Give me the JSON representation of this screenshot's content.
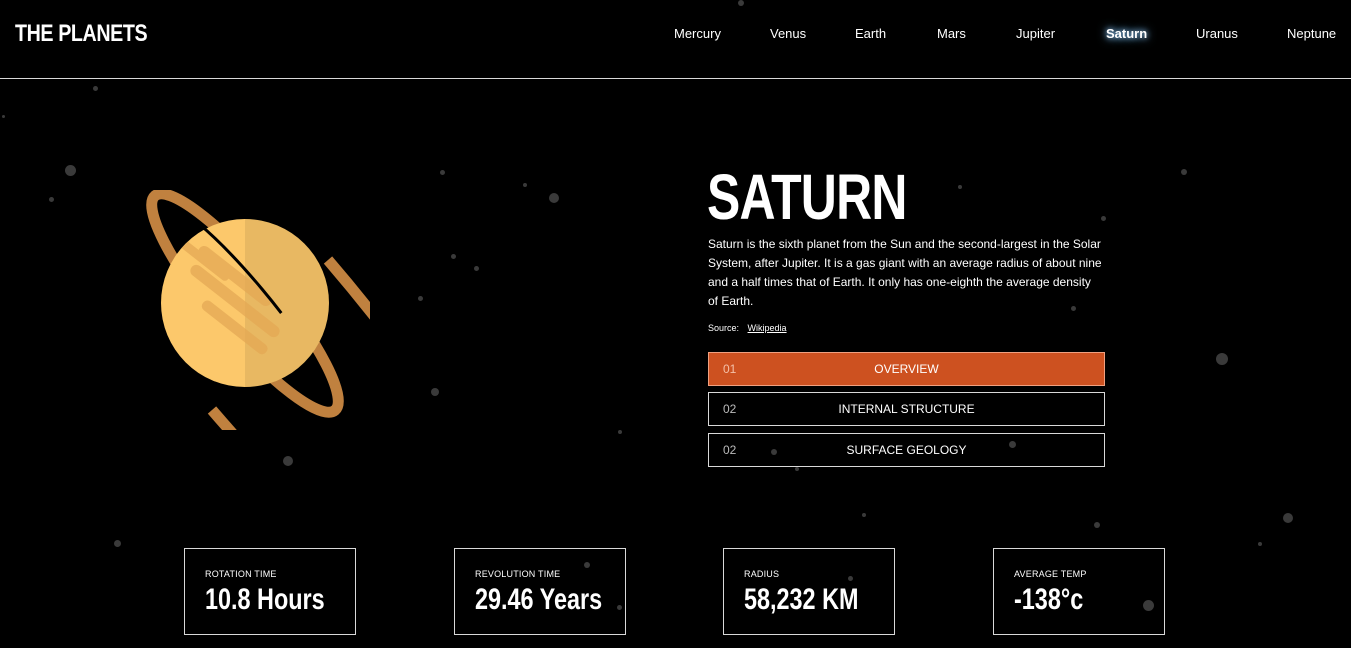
{
  "header": {
    "logo": "THE PLANETS",
    "nav": [
      "Mercury",
      "Venus",
      "Earth",
      "Mars",
      "Jupiter",
      "Saturn",
      "Uranus",
      "Neptune"
    ],
    "active": "Saturn"
  },
  "planet": {
    "name": "SATURN",
    "description": "Saturn is the sixth planet from the Sun and the second-largest in the Solar System, after Jupiter. It is a gas giant with an average radius of about nine and a half times that of Earth. It only has one-eighth the average density of Earth.",
    "source_label": "Source:",
    "source_link": "Wikipedia"
  },
  "tabs": [
    {
      "num": "01",
      "label": "OVERVIEW"
    },
    {
      "num": "02",
      "label": "INTERNAL STRUCTURE"
    },
    {
      "num": "02",
      "label": "SURFACE GEOLOGY"
    }
  ],
  "stats": [
    {
      "label": "ROTATION TIME",
      "value": "10.8 Hours"
    },
    {
      "label": "REVOLUTION TIME",
      "value": "29.46 Years"
    },
    {
      "label": "RADIUS",
      "value": "58,232 KM"
    },
    {
      "label": "AVERAGE TEMP",
      "value": "-138°c"
    }
  ],
  "colors": {
    "accent": "#cd5120",
    "planet_light": "#fcc86b",
    "planet_shade": "#e8b862",
    "ring": "#c0813f",
    "border": "#d9d9d9"
  }
}
